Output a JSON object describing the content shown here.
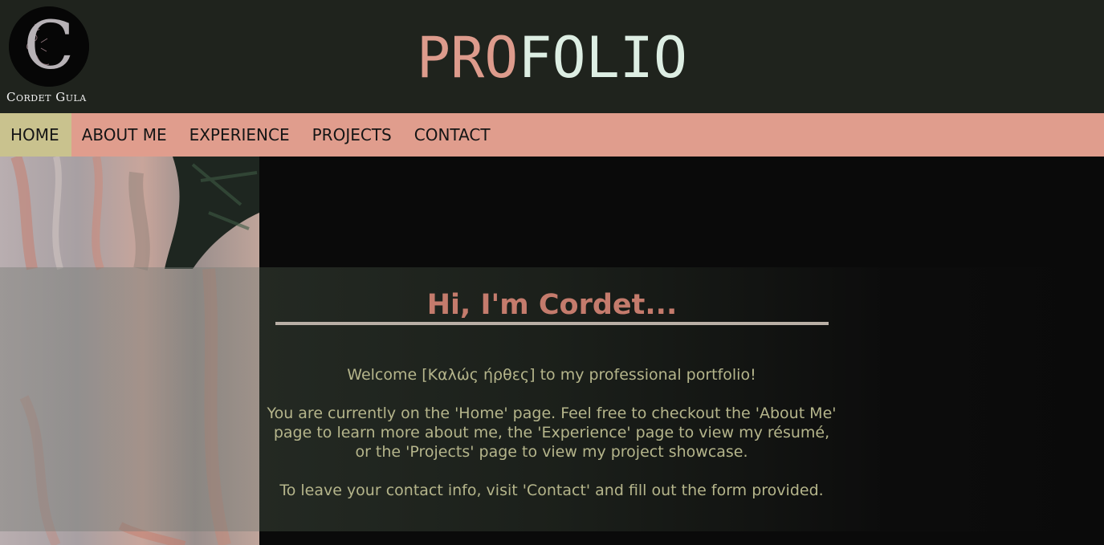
{
  "header": {
    "logo_letter": "C",
    "logo_name": "Cordet Gula",
    "title_part1": "PRO",
    "title_part2": "FOLIO"
  },
  "nav": {
    "items": [
      {
        "label": "HOME",
        "active": true
      },
      {
        "label": "ABOUT ME",
        "active": false
      },
      {
        "label": "EXPERIENCE",
        "active": false
      },
      {
        "label": "PROJECTS",
        "active": false
      },
      {
        "label": "CONTACT",
        "active": false
      }
    ]
  },
  "main": {
    "greeting": "Hi, I'm Cordet...",
    "welcome": "Welcome [Καλώς ήρθες] to my professional portfolio!",
    "info_lines": [
      "You are currently on the 'Home' page. Feel free to checkout the 'About Me'",
      "page to learn more about me, the 'Experience' page to view my résumé,",
      "or the 'Projects' page to view my project showcase."
    ],
    "contact_line": "To leave your contact info, visit 'Contact' and fill out the form provided."
  },
  "colors": {
    "header_bg": "#1f231d",
    "nav_bg": "#e09d8d",
    "nav_active_bg": "#c9c28e",
    "title_accent": "#dd9b8c",
    "title_light": "#ddeee3",
    "greeting": "#c47b6c",
    "body_text": "#b5b58b",
    "page_bg": "#0a0a0a"
  }
}
